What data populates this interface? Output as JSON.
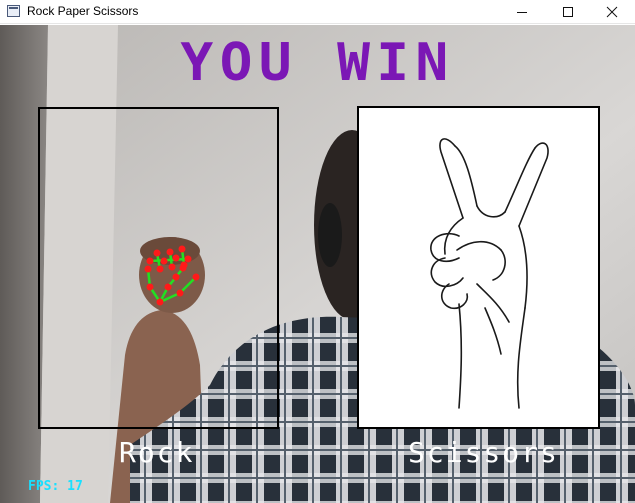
{
  "window": {
    "title": "Rock Paper Scissors",
    "controls": [
      "minimize-icon",
      "maximize-icon",
      "close-icon"
    ]
  },
  "game": {
    "result": "YOU WIN",
    "player_move": "Rock",
    "computer_move": "Scissors",
    "fps": "FPS: 17"
  },
  "colors": {
    "result_text": "#7b17b5",
    "move_labels": "#ffffff",
    "fps_text": "#19e0ff",
    "hand_landmarks": "#ff1a1a",
    "hand_connections": "#22e022"
  }
}
